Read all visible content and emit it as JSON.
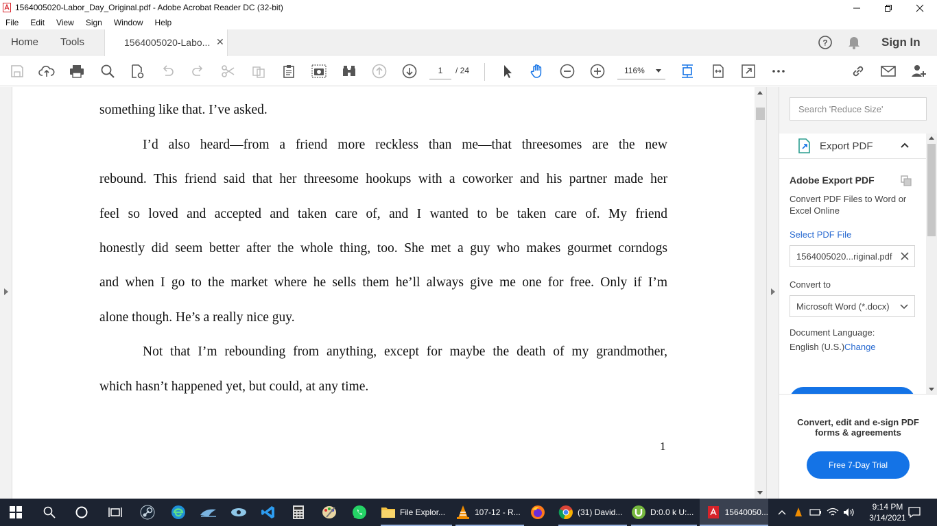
{
  "window": {
    "title": "1564005020-Labor_Day_Original.pdf - Adobe Acrobat Reader DC (32-bit)"
  },
  "menu": [
    "File",
    "Edit",
    "View",
    "Sign",
    "Window",
    "Help"
  ],
  "tabs": {
    "home": "Home",
    "tools": "Tools",
    "document": "1564005020-Labo...",
    "sign_in": "Sign In"
  },
  "toolbar": {
    "page_current": "1",
    "page_total": "/ 24",
    "zoom": "116%"
  },
  "document": {
    "lines": [
      "something like that. I’ve asked.",
      "I’d also heard—from a friend more reckless than me—that threesomes are the new",
      "rebound. This friend said that her threesome hookups with a coworker and his partner made her",
      "feel so loved and accepted and taken care of, and I wanted to be taken care of. My friend",
      "honestly did seem better after the whole thing, too. She met a guy who makes gourmet corndogs",
      "and when I go to the market where he sells them he’ll always give me one for free. Only if I’m",
      "alone though. He’s a really nice guy.",
      "Not that I’m rebounding from anything, except for maybe the death of my grandmother,",
      "which hasn’t happened yet, but could, at any time."
    ],
    "page_number": "1"
  },
  "panel": {
    "search_placeholder": "Search 'Reduce Size'",
    "export_header": "Export PDF",
    "export_title": "Adobe Export PDF",
    "export_desc": "Convert PDF Files to Word or Excel Online",
    "select_file_label": "Select PDF File",
    "selected_file": "1564005020...riginal.pdf",
    "convert_to_label": "Convert to",
    "convert_to_value": "Microsoft Word (*.docx)",
    "language_label": "Document Language:",
    "language_value": "English (U.S.)",
    "language_change": "Change",
    "promo_text": "Convert, edit and e-sign PDF forms & agreements",
    "trial_button": "Free 7-Day Trial"
  },
  "taskbar": {
    "items": [
      {
        "label": "File Explor..."
      },
      {
        "label": "107-12 - R..."
      },
      {
        "label": "(31) David..."
      },
      {
        "label": "D:0.0 k U:..."
      },
      {
        "label": "15640050..."
      }
    ],
    "time": "9:14 PM",
    "date": "3/14/2021"
  },
  "colors": {
    "accent": "#1473e6",
    "link": "#2a6bd1",
    "taskbar": "#1c2331",
    "acrobat_red": "#d7232a"
  }
}
